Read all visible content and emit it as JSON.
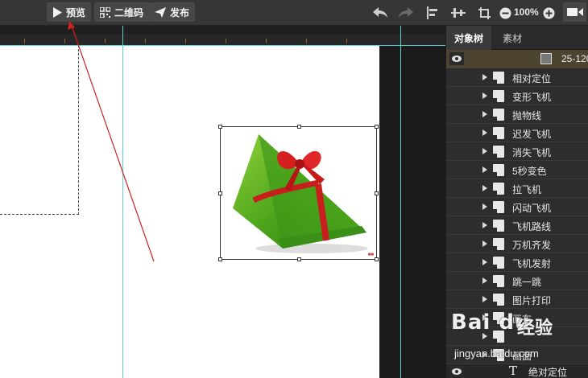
{
  "toolbar": {
    "preview_label": "预览",
    "qrcode_label": "二维码",
    "publish_label": "发布",
    "zoom_value": "100%"
  },
  "panel": {
    "tabs": [
      {
        "label": "对象树",
        "active": true
      },
      {
        "label": "素材",
        "active": false
      }
    ],
    "group_label": "25-120",
    "layers": [
      {
        "label": "相对定位"
      },
      {
        "label": "变形飞机"
      },
      {
        "label": "抛物线"
      },
      {
        "label": "迟发飞机"
      },
      {
        "label": "消失飞机"
      },
      {
        "label": "5秒变色"
      },
      {
        "label": "拉飞机"
      },
      {
        "label": "闪动飞机"
      },
      {
        "label": "飞机路线"
      },
      {
        "label": "万机齐发"
      },
      {
        "label": "飞机发射"
      },
      {
        "label": "跳一跳"
      },
      {
        "label": "图片打印"
      },
      {
        "label": "画布"
      },
      {
        "label": ""
      },
      {
        "label": "画面"
      }
    ],
    "last_layer_label": "绝对定位"
  },
  "watermark": {
    "logo": "Bai du",
    "text": "经验",
    "url": "jingyan.baidu.com"
  },
  "colors": {
    "guide": "#59d3d8",
    "annotation_arrow": "#cc2222",
    "group_highlight": "#4d4331"
  }
}
